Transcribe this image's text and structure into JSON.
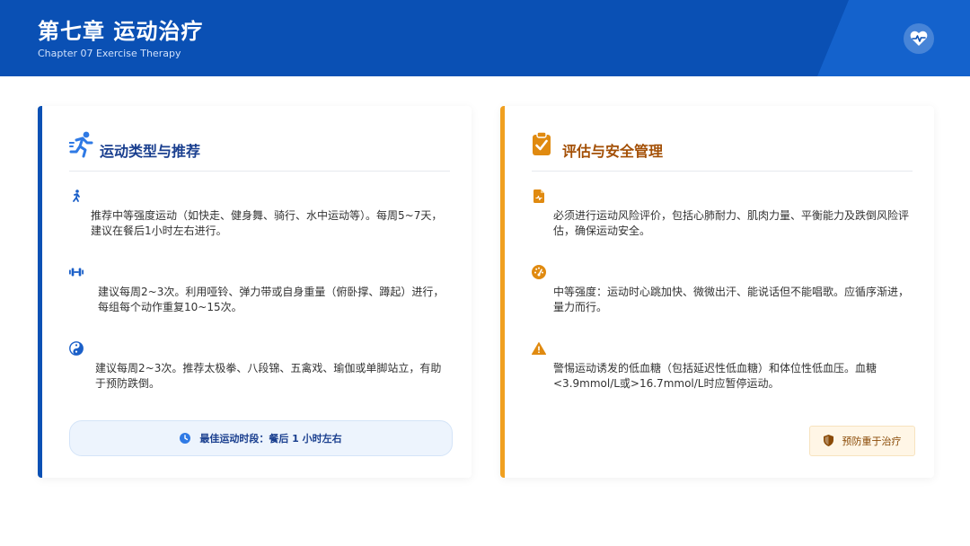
{
  "header": {
    "title": "第七章 运动治疗",
    "subtitle": "Chapter 07 Exercise Therapy",
    "badge_icon": "heart-pulse-icon"
  },
  "left_card": {
    "accent_color": "#0a50b4",
    "title": "运动类型与推荐",
    "title_icon": "running-person-icon",
    "items": [
      {
        "icon": "walking-person-icon",
        "text": "推荐中等强度运动（如快走、健身舞、骑行、水中运动等）。每周5~7天，建议在餐后1小时左右进行。"
      },
      {
        "icon": "dumbbell-icon",
        "text": "建议每周2~3次。利用哑铃、弹力带或自身重量（俯卧撑、蹲起）进行，每组每个动作重复10~15次。"
      },
      {
        "icon": "yin-yang-icon",
        "text": "建议每周2~3次。推荐太极拳、八段锦、五禽戏、瑜伽或单脚站立，有助于预防跌倒。"
      }
    ],
    "footer": {
      "icon": "clock-icon",
      "text": "最佳运动时段：餐后 1 小时左右"
    }
  },
  "right_card": {
    "accent_color": "#f0a020",
    "title": "评估与安全管理",
    "title_icon": "clipboard-check-icon",
    "items": [
      {
        "icon": "medical-file-icon",
        "text": "必须进行运动风险评价，包括心肺耐力、肌肉力量、平衡能力及跌倒风险评估，确保运动安全。"
      },
      {
        "icon": "gauge-icon",
        "text": "中等强度：运动时心跳加快、微微出汗、能说话但不能唱歌。应循序渐进，量力而行。"
      },
      {
        "icon": "warning-triangle-icon",
        "text": "警惕运动诱发的低血糖（包括延迟性低血糖）和体位性低血压。血糖<3.9mmol/L或>16.7mmol/L时应暂停运动。"
      }
    ],
    "footer": {
      "icon": "shield-icon",
      "text": "预防重于治疗"
    }
  }
}
